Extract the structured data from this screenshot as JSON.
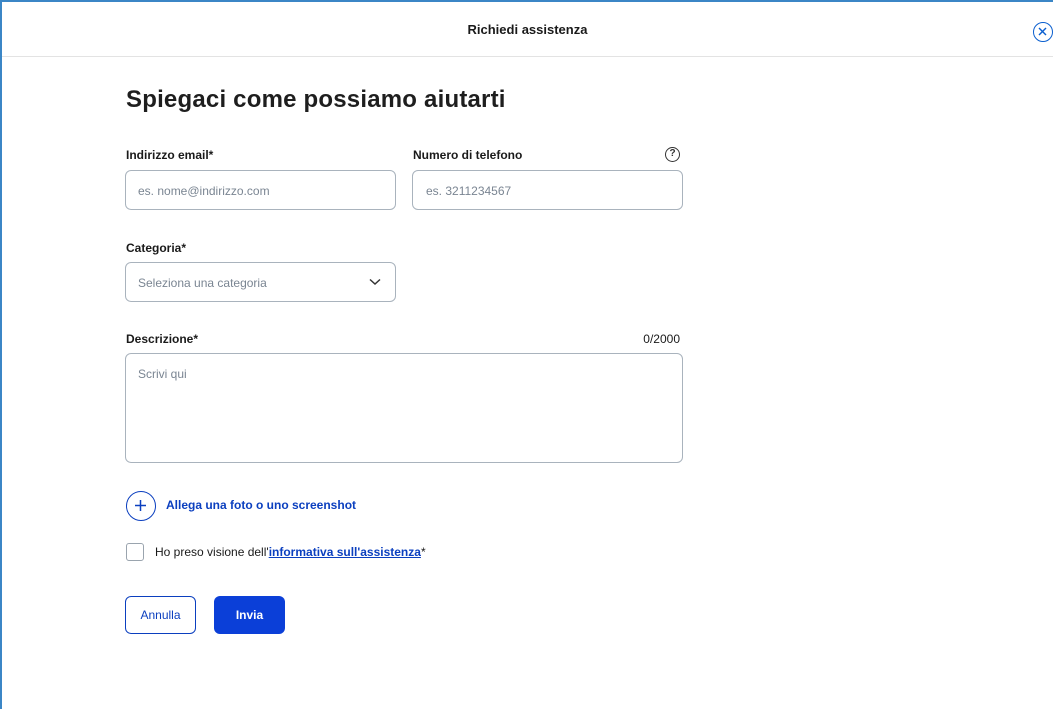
{
  "header": {
    "title": "Richiedi assistenza",
    "close_icon": "close-circle-icon"
  },
  "form": {
    "title": "Spiegaci come possiamo aiutarti",
    "email": {
      "label": "Indirizzo email*",
      "placeholder": "es. nome@indirizzo.com",
      "value": ""
    },
    "phone": {
      "label": "Numero di telefono",
      "placeholder": "es. 3211234567",
      "value": "",
      "help_icon": "question-circle-icon",
      "help_glyph": "?"
    },
    "category": {
      "label": "Categoria*",
      "placeholder": "Seleziona una categoria",
      "chevron_icon": "chevron-down-icon"
    },
    "description": {
      "label": "Descrizione*",
      "counter": "0/2000",
      "placeholder": "Scrivi qui",
      "value": ""
    },
    "attachment": {
      "label": "Allega una foto o uno screenshot",
      "icon": "plus-circle-icon"
    },
    "consent": {
      "text_before": "Ho preso visione dell'",
      "link_text": "informativa sull'assistenza",
      "text_after": "*",
      "checked": false
    },
    "buttons": {
      "cancel": "Annulla",
      "submit": "Invia"
    }
  },
  "colors": {
    "primary": "#0b3fd8",
    "frame_border": "#3b86c6",
    "input_border": "#a9b3bd",
    "placeholder": "#7a8592"
  }
}
